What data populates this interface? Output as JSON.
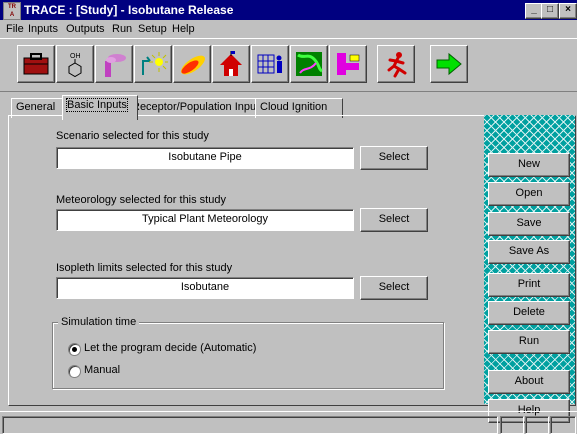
{
  "window": {
    "title": "TRACE : [Study] - Isobutane Release",
    "icon_text": "TR\nA",
    "controls": [
      "_",
      "□",
      "×"
    ]
  },
  "menu": [
    "File",
    "Inputs",
    "Outputs",
    "Run",
    "Setup",
    "Help"
  ],
  "toolbar": [
    {
      "icon": "briefcase-icon"
    },
    {
      "icon": "chemical-ring-icon",
      "text": "OH"
    },
    {
      "icon": "chimney-icon"
    },
    {
      "icon": "sun-leak-icon"
    },
    {
      "icon": "plume-icon"
    },
    {
      "icon": "house-icon"
    },
    {
      "icon": "grid-person-icon"
    },
    {
      "icon": "map-icon"
    },
    {
      "icon": "blocks-icon"
    },
    {
      "icon": "running-person-icon"
    },
    {
      "icon": "green-arrow-icon"
    }
  ],
  "tabs": [
    "General",
    "Basic Inputs",
    "Receptor/Population Inputs",
    "Cloud Ignition"
  ],
  "active_tab": 1,
  "scenario": {
    "label": "Scenario selected for this study",
    "value": "Isobutane Pipe",
    "button": "Select"
  },
  "meteorology": {
    "label": "Meteorology selected for this study",
    "value": "Typical Plant Meteorology",
    "button": "Select"
  },
  "isopleth": {
    "label": "Isopleth limits selected for this study",
    "value": "Isobutane",
    "button": "Select"
  },
  "simulation": {
    "legend": "Simulation time",
    "options": [
      {
        "label": "Let the program decide (Automatic)",
        "selected": true
      },
      {
        "label": "Manual",
        "selected": false
      }
    ]
  },
  "actions": [
    "New",
    "Open",
    "Save",
    "Save As",
    "Print",
    "Delete",
    "Run",
    "About",
    "Help"
  ],
  "colors": {
    "titlebar": "#000080",
    "accent_hatch": "#00a0a0",
    "face": "#c0c0c0"
  }
}
